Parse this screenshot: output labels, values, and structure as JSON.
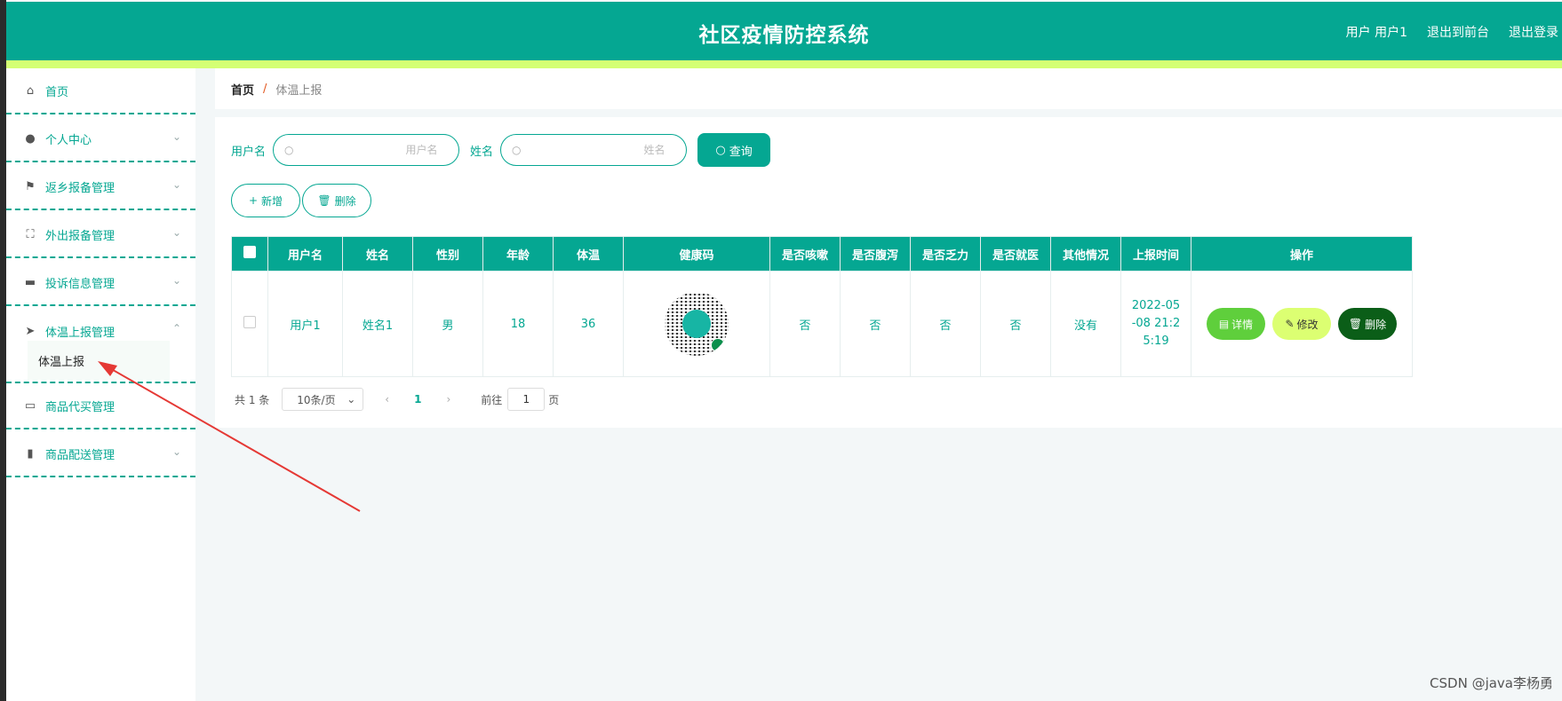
{
  "header": {
    "title": "社区疫情防控系统",
    "user_label": "用户 用户1",
    "back_to_front": "退出到前台",
    "logout": "退出登录"
  },
  "sidebar": {
    "items": [
      {
        "label": "首页",
        "icon": "home-icon"
      },
      {
        "label": "个人中心",
        "icon": "user-icon"
      },
      {
        "label": "返乡报备管理",
        "icon": "flag-icon"
      },
      {
        "label": "外出报备管理",
        "icon": "fullscreen-icon"
      },
      {
        "label": "投诉信息管理",
        "icon": "ticket-icon"
      },
      {
        "label": "体温上报管理",
        "icon": "send-icon"
      },
      {
        "label": "商品代买管理",
        "icon": "picture-icon"
      },
      {
        "label": "商品配送管理",
        "icon": "box-icon"
      }
    ],
    "sub_item": "体温上报"
  },
  "breadcrumb": {
    "home": "首页",
    "separator": "/",
    "current": "体温上报"
  },
  "search": {
    "username_label": "用户名",
    "username_placeholder": "用户名",
    "name_label": "姓名",
    "name_placeholder": "姓名",
    "query_button": "查询"
  },
  "actions": {
    "add": "新增",
    "delete": "删除"
  },
  "table": {
    "headers": [
      "用户名",
      "姓名",
      "性别",
      "年龄",
      "体温",
      "健康码",
      "是否咳嗽",
      "是否腹泻",
      "是否乏力",
      "是否就医",
      "其他情况",
      "上报时间",
      "操作"
    ],
    "rows": [
      {
        "username": "用户1",
        "name": "姓名1",
        "gender": "男",
        "age": "18",
        "temperature": "36",
        "cough": "否",
        "diarrhea": "否",
        "fatigue": "否",
        "medical": "否",
        "other": "没有",
        "report_time": "2022-05-08 21:25:19",
        "detail_btn": "详情",
        "edit_btn": "修改",
        "delete_btn": "删除"
      }
    ]
  },
  "pagination": {
    "total": "共 1 条",
    "page_size": "10条/页",
    "current_page": "1",
    "goto_label": "前往",
    "goto_value": "1",
    "page_unit": "页"
  },
  "watermark": "CSDN @java李杨勇",
  "colors": {
    "primary": "#05a792",
    "accent": "#d4ff74",
    "detail": "#5fcf3c",
    "edit": "#dcff72",
    "delete": "#0b5e18",
    "annotation_arrow": "#e53935"
  }
}
